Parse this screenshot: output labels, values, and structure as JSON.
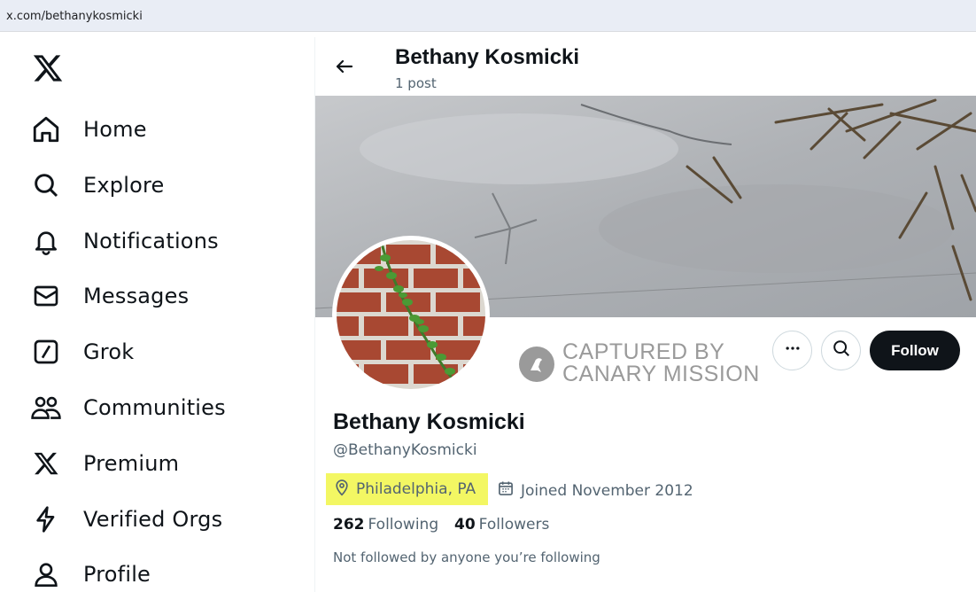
{
  "browser": {
    "url": "x.com/bethanykosmicki"
  },
  "nav": {
    "items": [
      {
        "label": "Home",
        "icon": "home-icon"
      },
      {
        "label": "Explore",
        "icon": "search-icon"
      },
      {
        "label": "Notifications",
        "icon": "bell-icon"
      },
      {
        "label": "Messages",
        "icon": "envelope-icon"
      },
      {
        "label": "Grok",
        "icon": "grok-icon"
      },
      {
        "label": "Communities",
        "icon": "communities-icon"
      },
      {
        "label": "Premium",
        "icon": "x-logo-icon"
      },
      {
        "label": "Verified Orgs",
        "icon": "lightning-icon"
      },
      {
        "label": "Profile",
        "icon": "person-icon"
      }
    ]
  },
  "header": {
    "name": "Bethany Kosmicki",
    "posts": "1 post"
  },
  "watermark": {
    "line1": "CAPTURED BY",
    "line2": "CANARY MISSION"
  },
  "actions": {
    "follow_label": "Follow"
  },
  "profile": {
    "name": "Bethany Kosmicki",
    "handle": "@BethanyKosmicki",
    "location": "Philadelphia, PA",
    "joined": "Joined November 2012",
    "following_count": "262",
    "following_label": "Following",
    "followers_count": "40",
    "followers_label": "Followers",
    "not_followed": "Not followed by anyone you’re following"
  },
  "colors": {
    "highlight": "#f3f763",
    "secondary_text": "#536471",
    "primary": "#0f1419"
  }
}
